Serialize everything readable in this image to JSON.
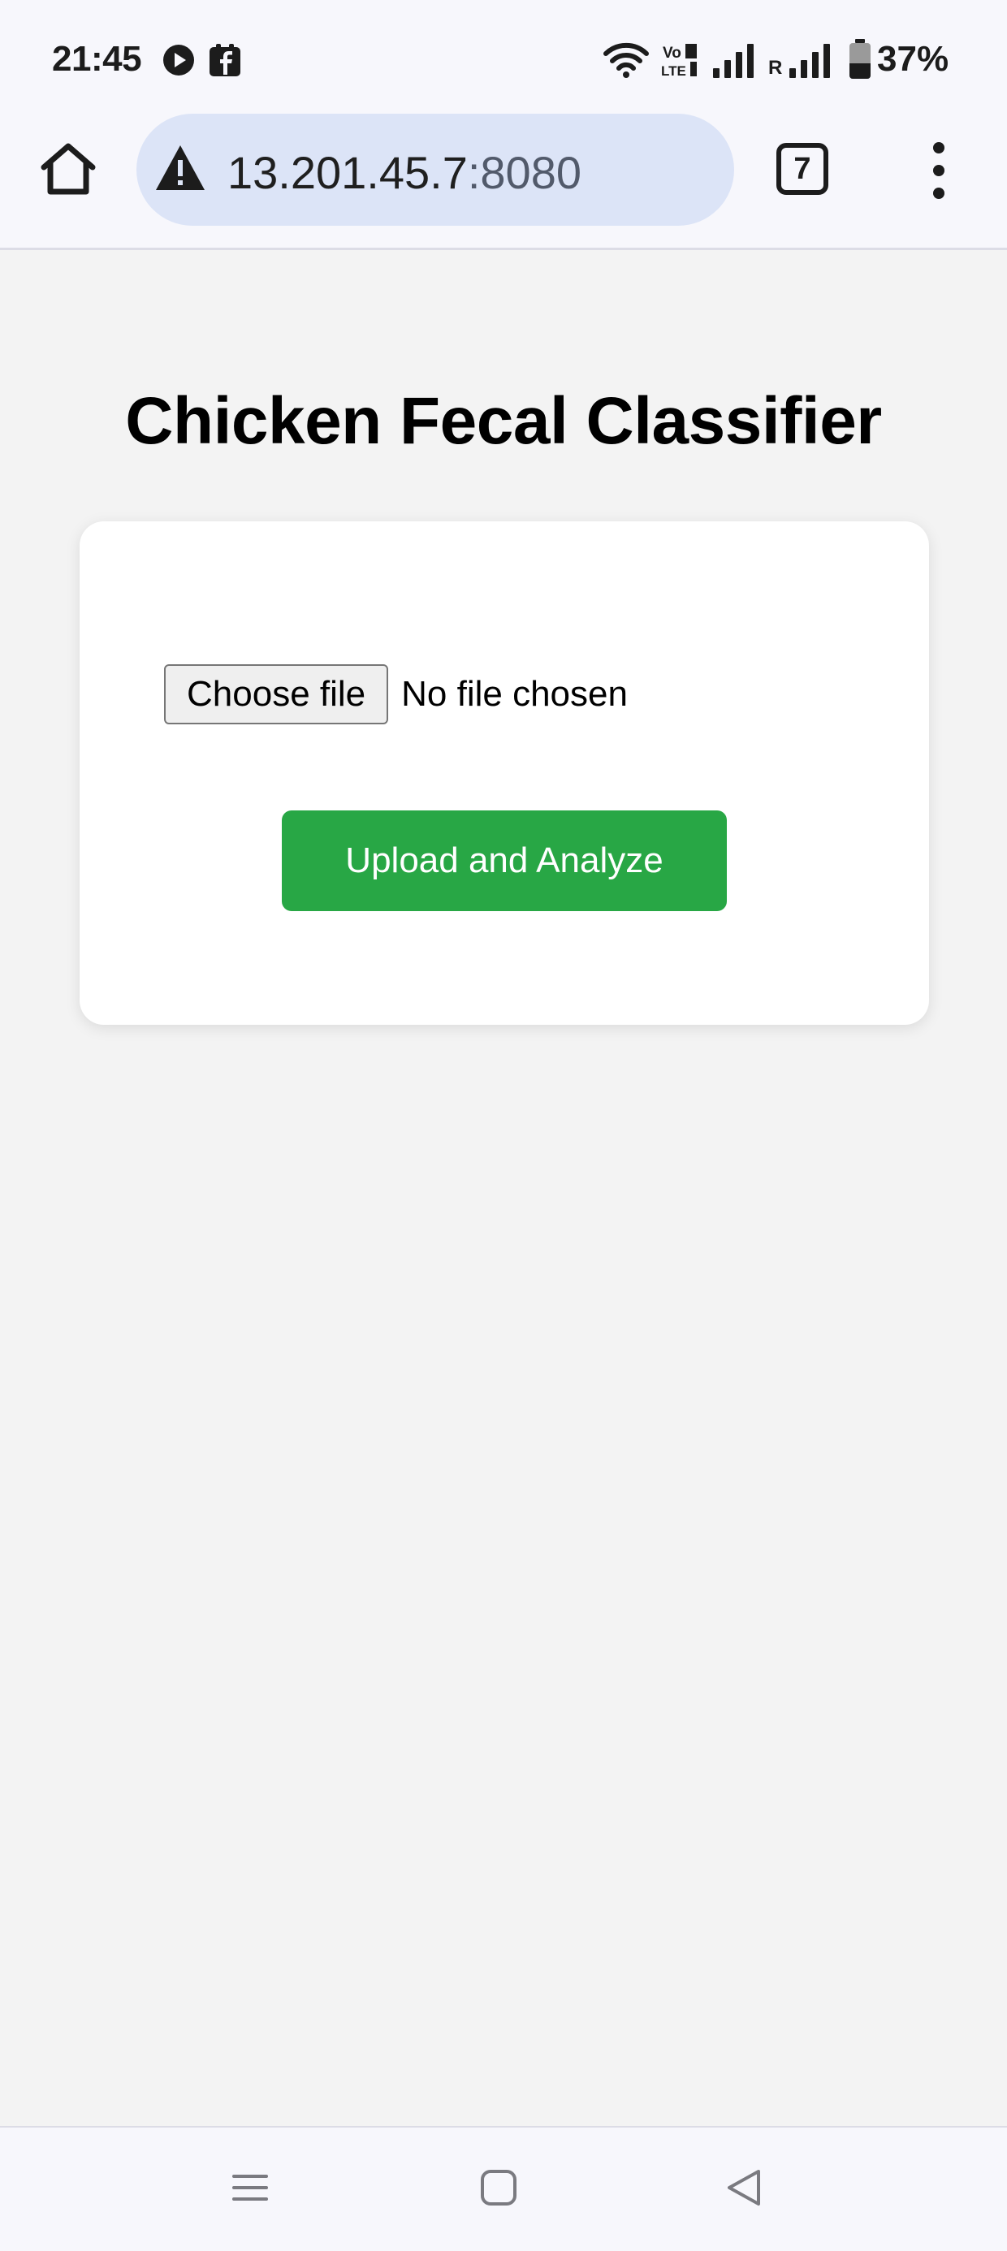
{
  "status_bar": {
    "time": "21:45",
    "battery_percent": "37%",
    "icons": [
      "play-icon",
      "facebook-icon",
      "wifi-icon",
      "volte-icon",
      "signal-icon",
      "roaming-signal-icon",
      "battery-icon"
    ],
    "roaming_label": "R"
  },
  "browser": {
    "url_host": "13.201.45.7",
    "url_port": ":8080",
    "tab_count": "7"
  },
  "page": {
    "title": "Chicken Fecal Classifier",
    "file_input": {
      "button_label": "Choose file",
      "status_text": "No file chosen"
    },
    "submit_label": "Upload and Analyze"
  },
  "colors": {
    "submit_button": "#28a745",
    "page_background": "#f3f3f3",
    "omnibox": "#dce4f7"
  }
}
